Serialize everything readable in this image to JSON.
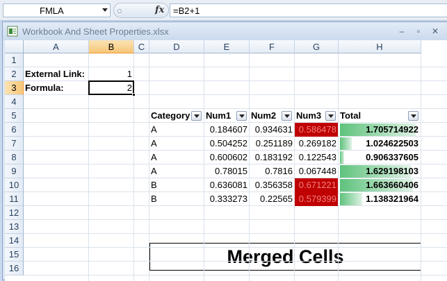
{
  "formula_bar": {
    "name_box": "FMLA",
    "fx_label": "fx",
    "formula": "=B2+1"
  },
  "window": {
    "title": "Workbook And Sheet Properties.xlsx",
    "minimize": "–",
    "restore": "▫",
    "close": "✕"
  },
  "columns": [
    "A",
    "B",
    "C",
    "D",
    "E",
    "F",
    "G",
    "H"
  ],
  "rows": [
    "1",
    "2",
    "3",
    "4",
    "5",
    "6",
    "7",
    "8",
    "9",
    "10",
    "11",
    "12",
    "13",
    "14",
    "15",
    "16"
  ],
  "selection": {
    "column": "B",
    "row": "3"
  },
  "cells": {
    "external_link_label": "External Link:",
    "external_link_value": "1",
    "formula_label": "Formula:",
    "formula_value": "2"
  },
  "table": {
    "headers": [
      "Category",
      "Num1",
      "Num2",
      "Num3",
      "Total"
    ],
    "rows": [
      [
        "A",
        "0.184607",
        "0.934631",
        "0.586478",
        "1.705714922"
      ],
      [
        "A",
        "0.504252",
        "0.251189",
        "0.269182",
        "1.024622503"
      ],
      [
        "A",
        "0.600602",
        "0.183192",
        "0.122543",
        "0.906337605"
      ],
      [
        "A",
        "0.78015",
        "0.7816",
        "0.067448",
        "1.629198103"
      ],
      [
        "B",
        "0.636081",
        "0.356358",
        "0.671221",
        "1.663660406"
      ],
      [
        "B",
        "0.333273",
        "0.22565",
        "0.579399",
        "1.138321964"
      ]
    ],
    "num3_highlight": [
      true,
      false,
      false,
      false,
      true,
      true
    ],
    "total_bar_fraction": [
      0.97,
      0.15,
      0.0,
      0.91,
      0.94,
      0.29
    ]
  },
  "merged_text": "Merged Cells",
  "colors": {
    "highlight_red": "#c00000",
    "databar_green": "#5ec27c"
  }
}
